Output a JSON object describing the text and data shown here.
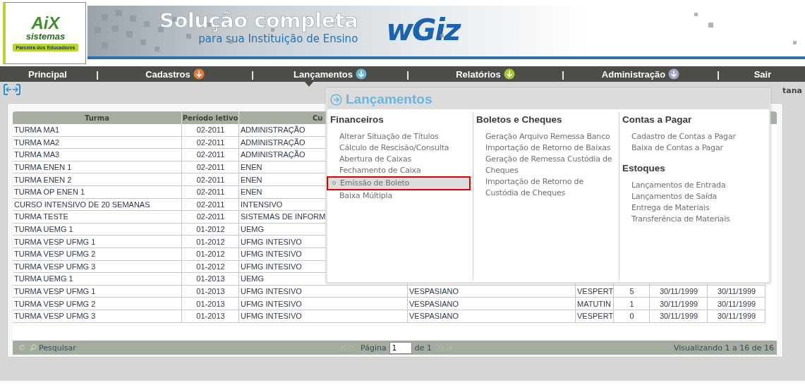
{
  "header": {
    "logo": {
      "name": "AiX",
      "subtitle": "sistemas",
      "tagline": "Parceira dos Educadores"
    },
    "banner": {
      "headline": "Solução completa",
      "subline": "para sua Instituição de Ensino",
      "brand": "wGiz"
    }
  },
  "nav": [
    {
      "label": "Principal",
      "selected": false
    },
    {
      "label": "Cadastros",
      "color": "#e07b3c",
      "selected": false
    },
    {
      "label": "Lançamentos",
      "color": "#6cb2de",
      "selected": true
    },
    {
      "label": "Relatórios",
      "color": "#a2c62c",
      "selected": false
    },
    {
      "label": "Administração",
      "color": "#a3a3c6",
      "selected": false
    },
    {
      "label": "Sair",
      "selected": false
    }
  ],
  "separator": "|",
  "user_label": "tana",
  "grid": {
    "columns": [
      "Turma",
      "Período letivo",
      "Cu"
    ],
    "rows": [
      [
        "TURMA MA1",
        "02-2011",
        "ADMINISTRAÇÃO"
      ],
      [
        "TURMA MA2",
        "02-2011",
        "ADMINISTRAÇÃO"
      ],
      [
        "TURMA MA3",
        "02-2011",
        "ADMINISTRAÇÃO"
      ],
      [
        "TURMA ENEN 1",
        "02-2011",
        "ENEN"
      ],
      [
        "TURMA ENEN 2",
        "02-2011",
        "ENEN"
      ],
      [
        "TURMA OP ENEN 1",
        "02-2011",
        "ENEN"
      ],
      [
        "CURSO INTENSIVO DE 20 SEMANAS",
        "02-2011",
        "INTENSIVO"
      ],
      [
        "TURMA TESTE",
        "02-2011",
        "SISTEMAS DE INFORM"
      ],
      [
        "TURMA UEMG 1",
        "01-2012",
        "UEMG"
      ],
      [
        "TURMA VESP UFMG 1",
        "01-2012",
        "UFMG INTESIVO"
      ],
      [
        "TURMA VESP UFMG 2",
        "01-2012",
        "UFMG INTESIVO"
      ],
      [
        "TURMA VESP UFMG 3",
        "01-2012",
        "UFMG INTESIVO"
      ],
      [
        "TURMA UEMG 1",
        "01-2013",
        "UEMG"
      ],
      [
        "TURMA VESP UFMG 1",
        "01-2013",
        "UFMG INTESIVO",
        "VESPASIANO",
        "VESPERT",
        "5",
        "30/11/1999",
        "30/11/1999"
      ],
      [
        "TURMA VESP UFMG 2",
        "01-2013",
        "UFMG INTESIVO",
        "VESPASIANO",
        "MATUTIN",
        "1",
        "30/11/1999",
        "30/11/1999"
      ],
      [
        "TURMA VESP UFMG 3",
        "01-2013",
        "UFMG INTESIVO",
        "VESPASIANO",
        "VESPERT",
        "0",
        "30/11/1999",
        "30/11/1999"
      ]
    ]
  },
  "pager": {
    "search": "Pesquisar",
    "page_label": "Página",
    "page": "1",
    "of": "de 1",
    "summary": "Visualizando 1 a 16 de 16"
  },
  "menu": {
    "title": "Lançamentos",
    "columns": [
      [
        {
          "title": "Financeiros",
          "items": [
            {
              "label": "Alterar Situação de Títulos",
              "selected": false
            },
            {
              "label": "Cálculo de Rescisão/Consulta",
              "selected": false
            },
            {
              "label": "Abertura de Caixas",
              "selected": false
            },
            {
              "label": "Fechamento de Caixa",
              "selected": false
            },
            {
              "label": "Emissão de Boleto",
              "selected": true
            },
            {
              "label": "Baixa Múltipla",
              "selected": false
            }
          ]
        }
      ],
      [
        {
          "title": "Boletos e Cheques",
          "items": [
            {
              "label": "Geração Arquivo Remessa Banco",
              "selected": false
            },
            {
              "label": "Importação de Retorno de Baixas",
              "selected": false
            },
            {
              "label": "Geração de Remessa Custódia de Cheques",
              "selected": false
            },
            {
              "label": "Importação de Retorno de Custódia de Cheques",
              "selected": false
            }
          ]
        }
      ],
      [
        {
          "title": "Contas a Pagar",
          "items": [
            {
              "label": "Cadastro de Contas a Pagar",
              "selected": false
            },
            {
              "label": "Baixa de Contas a Pagar",
              "selected": false
            }
          ]
        },
        {
          "title": "Estoques",
          "items": [
            {
              "label": "Lançamentos de Entrada",
              "selected": false
            },
            {
              "label": "Lançamentos de Saída",
              "selected": false
            },
            {
              "label": "Entrega de Materiais",
              "selected": false
            },
            {
              "label": "Transferência de Materiais",
              "selected": false
            }
          ]
        }
      ]
    ]
  }
}
